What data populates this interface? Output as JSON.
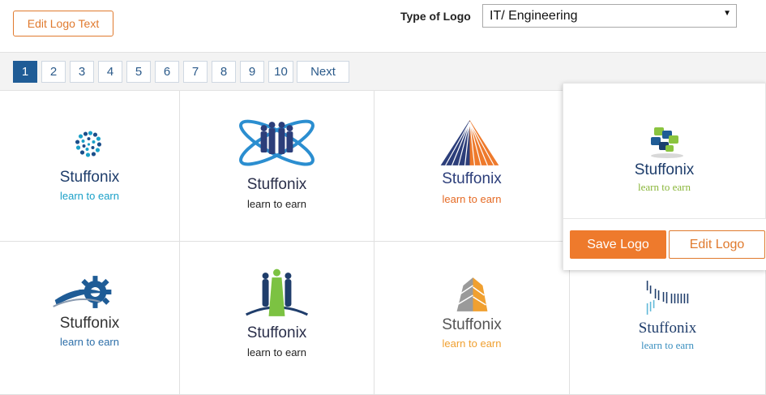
{
  "toolbar": {
    "edit_logo_text": "Edit Logo Text"
  },
  "filter": {
    "label": "Type of Logo",
    "selected": "IT/ Engineering"
  },
  "pagination": {
    "pages": [
      "1",
      "2",
      "3",
      "4",
      "5",
      "6",
      "7",
      "8",
      "9",
      "10"
    ],
    "active": "1",
    "next": "Next"
  },
  "logos": [
    {
      "brand": "Stuffonix",
      "tagline": "learn to earn",
      "tag_color": "#1aa0c8",
      "icon": "dot-burst-icon"
    },
    {
      "brand": "Stuffonix",
      "tagline": "learn to earn",
      "tag_color": "#222222",
      "icon": "team-orbit-icon"
    },
    {
      "brand": "Stuffonix",
      "tagline": "learn to earn",
      "tag_color": "#e56a24",
      "icon": "triangle-rays-icon"
    },
    {
      "brand": "Stuffonix",
      "tagline": "learn to earn",
      "tag_color": "#8ab63a",
      "icon": "puzzle-cross-icon"
    },
    {
      "brand": "Stuffonix",
      "tagline": "learn to earn",
      "tag_color": "#2c6ea8",
      "icon": "gear-swoosh-icon"
    },
    {
      "brand": "Stuffonix",
      "tagline": "learn to earn",
      "tag_color": "#222222",
      "icon": "people-silhouette-icon"
    },
    {
      "brand": "Stuffonix",
      "tagline": "learn to earn",
      "tag_color": "#f0a030",
      "icon": "building-block-icon"
    },
    {
      "brand": "Stuffonix",
      "tagline": "learn to earn",
      "tag_color": "#3a8fbf",
      "icon": "barcode-wave-icon"
    }
  ],
  "popup": {
    "save": "Save Logo",
    "edit": "Edit Logo"
  }
}
